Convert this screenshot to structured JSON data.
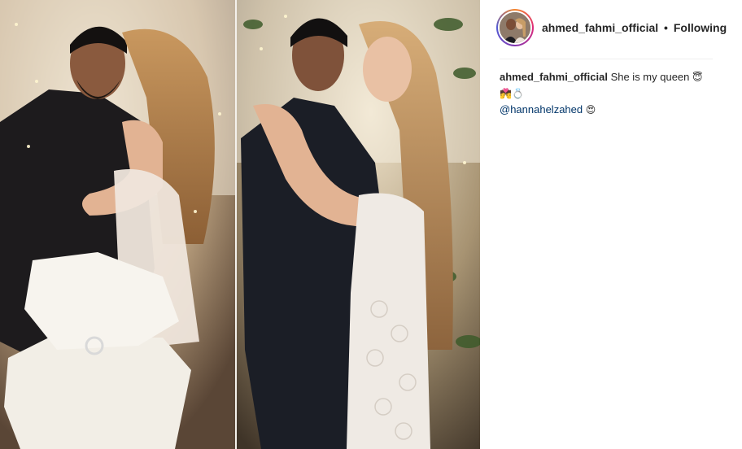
{
  "post": {
    "author": "ahmed_fahmi_official",
    "separator": "•",
    "follow_status": "Following",
    "caption": {
      "author": "ahmed_fahmi_official",
      "text": "She is my queen",
      "emoji_1": "😇",
      "emoji_line": "💏💍",
      "mention": "@hannahelzahed",
      "emoji_2": "😍"
    },
    "media_description_icons": [
      "avatar",
      "photo-left",
      "photo-right"
    ]
  }
}
